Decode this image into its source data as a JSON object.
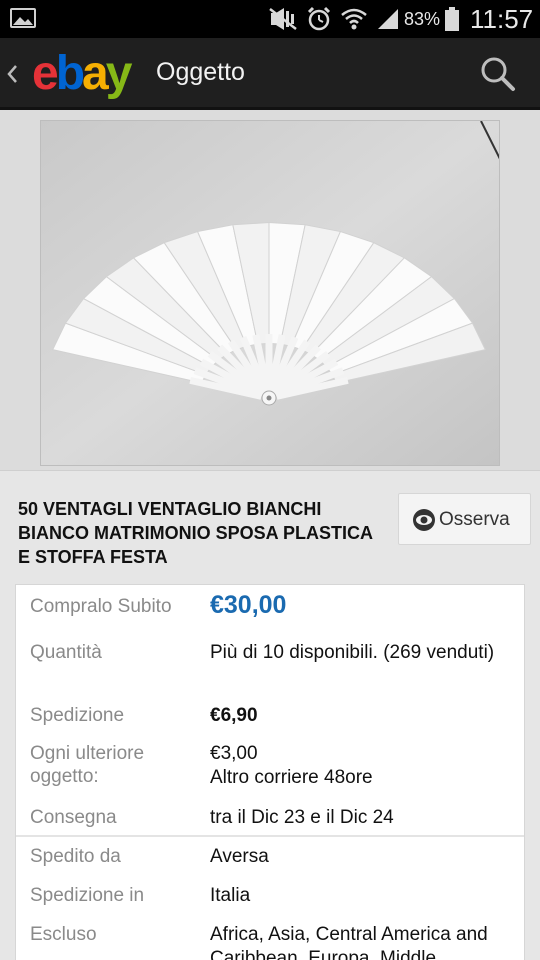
{
  "status_bar": {
    "icons": [
      "gallery-icon",
      "mute-icon",
      "alarm-icon",
      "wifi-icon",
      "signal-icon",
      "battery-icon"
    ],
    "battery": "83%",
    "time": "11:57"
  },
  "app_bar": {
    "logo": {
      "e": "e",
      "b": "b",
      "a": "a",
      "y": "y"
    },
    "title": "Oggetto",
    "back_icon": "chevron-left-icon",
    "search_icon": "search-icon"
  },
  "item": {
    "title": "50 VENTAGLI VENTAGLIO BIANCHI BIANCO MATRIMONIO SPOSA PLASTICA E STOFFA FESTA",
    "watch_label": "Osserva",
    "watch_icon": "eye-icon"
  },
  "details": {
    "buy_now_label": "Compralo Subito",
    "buy_now_price": "€30,00",
    "quantity_label": "Quantità",
    "quantity_value": "Più di 10 disponibili. (269 venduti)",
    "shipping_label": "Spedizione",
    "shipping_value": "€6,90",
    "additional_label": "Ogni ulteriore oggetto:",
    "additional_value_line1": "€3,00",
    "additional_value_line2": "Altro corriere 48ore",
    "delivery_label": "Consegna",
    "delivery_value": "tra il Dic 23 e il Dic 24",
    "ships_from_label": "Spedito da",
    "ships_from_value": "Aversa",
    "ships_to_label": "Spedizione in",
    "ships_to_value": "Italia",
    "excluded_label": "Escluso",
    "excluded_value": "Africa, Asia, Central America and Caribbean, Europa, Middle"
  },
  "colors": {
    "price": "#1a6ab0",
    "app_bar": "#1f1f1f",
    "ebay_red": "#e53238",
    "ebay_blue": "#0064d2",
    "ebay_yellow": "#f5af02",
    "ebay_green": "#86b817"
  }
}
